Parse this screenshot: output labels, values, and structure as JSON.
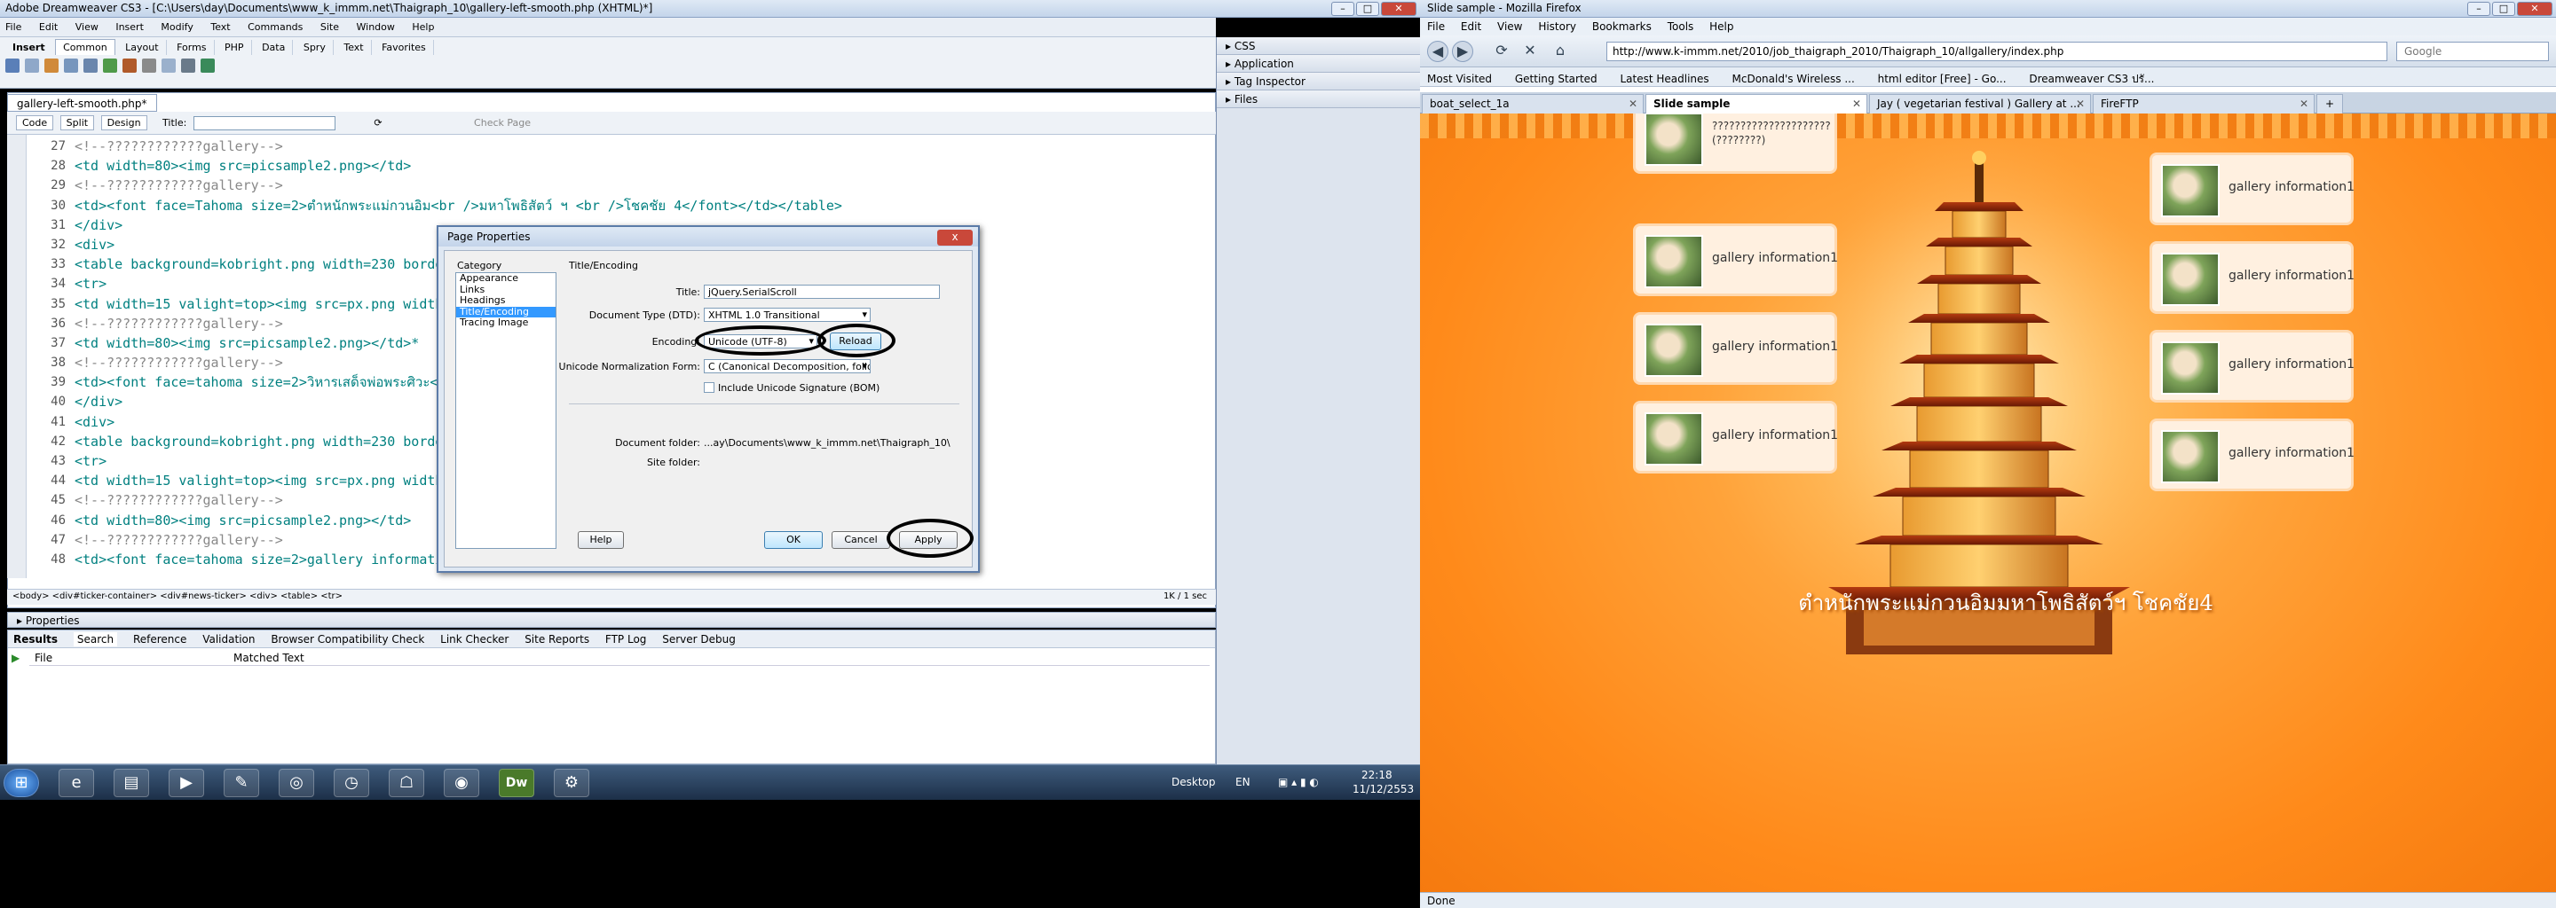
{
  "dreamweaver": {
    "title": "Adobe Dreamweaver CS3 - [C:\\Users\\day\\Documents\\www_k_immm.net\\Thaigraph_10\\gallery-left-smooth.php (XHTML)*]",
    "menu": [
      "File",
      "Edit",
      "View",
      "Insert",
      "Modify",
      "Text",
      "Commands",
      "Site",
      "Window",
      "Help"
    ],
    "insert_label": "Insert",
    "insert_tabs": [
      "Common",
      "Layout",
      "Forms",
      "PHP",
      "Data",
      "Spry",
      "Text",
      "Favorites"
    ],
    "panels": [
      "CSS",
      "Application",
      "Tag Inspector",
      "Files"
    ],
    "doc_tab": "gallery-left-smooth.php*",
    "view_buttons": {
      "code": "Code",
      "split": "Split",
      "design": "Design"
    },
    "title_label": "Title:",
    "check_page": "Check Page",
    "line_numbers": [
      "27",
      "28",
      "29",
      "30",
      "31",
      "32",
      "33",
      "34",
      "35",
      "36",
      "37",
      "38",
      "39",
      "40",
      "41",
      "42",
      "43",
      "44",
      "45",
      "46",
      "47",
      "48"
    ],
    "code_lines": [
      "<!--????????????gallery-->",
      "<td width=80><img src=picsample2.png></td>",
      "<!--????????????gallery-->",
      "<td><font face=Tahoma size=2>ตำหนักพระแม่กวนอิม<br />มหาโพธิสัตว์ ฯ <br />โชคชัย 4</font></td></table>",
      "            </div>",
      "            <div>",
      "<table background=kobright.png width=230 border=",
      "<tr>",
      "<td width=15 valight=top><img src=px.png width=1",
      "<!--????????????gallery-->",
      "<td width=80><img src=picsample2.png></td>*",
      "<!--????????????gallery-->",
      "<td><font face=tahoma size=2>วิหารเสด็จพ่อพระศิวะ<",
      "            </div>",
      "            <div>",
      "<table background=kobright.png width=230 border=",
      "<tr>",
      "<td width=15 valight=top><img src=px.png width=1",
      "<!--????????????gallery-->",
      "<td width=80><img src=picsample2.png></td>",
      "<!--????????????gallery-->",
      "<td><font face=tahoma size=2>gallery information1"
    ],
    "status_path": "<body> <div#ticker-container> <div#news-ticker> <div> <table> <tr>",
    "status_right": "1K / 1 sec",
    "properties": "Properties",
    "results_label": "Results",
    "results_tabs": [
      "Search",
      "Reference",
      "Validation",
      "Browser Compatibility Check",
      "Link Checker",
      "Site Reports",
      "FTP Log",
      "Server Debug"
    ],
    "results_cols": {
      "file": "File",
      "matched": "Matched Text"
    }
  },
  "dialog": {
    "title": "Page Properties",
    "category_label": "Category",
    "categories": [
      "Appearance",
      "Links",
      "Headings",
      "Title/Encoding",
      "Tracing Image"
    ],
    "section": "Title/Encoding",
    "title_field_label": "Title:",
    "title_value": "jQuery.SerialScroll",
    "doctype_label": "Document Type (DTD):",
    "doctype_value": "XHTML 1.0 Transitional",
    "encoding_label": "Encoding:",
    "encoding_value": "Unicode (UTF-8)",
    "reload": "Reload",
    "normalization_label": "Unicode Normalization Form:",
    "normalization_value": "C (Canonical Decomposition, follow",
    "bom_label": "Include Unicode Signature (BOM)",
    "docfolder_label": "Document folder:",
    "docfolder_value": "...ay\\Documents\\www_k_immm.net\\Thaigraph_10\\",
    "sitefolder_label": "Site folder:",
    "help": "Help",
    "ok": "OK",
    "cancel": "Cancel",
    "apply": "Apply",
    "close": "x"
  },
  "taskbar": {
    "desktop": "Desktop",
    "lang": "EN",
    "time": "22:18",
    "date": "11/12/2553",
    "dw_label": "Dw"
  },
  "firefox": {
    "title": "Slide sample - Mozilla Firefox",
    "menu": [
      "File",
      "Edit",
      "View",
      "History",
      "Bookmarks",
      "Tools",
      "Help"
    ],
    "url": "http://www.k-immm.net/2010/job_thaigraph_2010/Thaigraph_10/allgallery/index.php",
    "search_placeholder": "Google",
    "bookmarks": [
      "Most Visited",
      "Getting Started",
      "Latest Headlines",
      "McDonald's Wireless ...",
      "html editor [Free] - Go...",
      "Dreamweaver CS3 ปรั..."
    ],
    "tabs": [
      "boat_select_1a",
      "Slide sample",
      "Jay ( vegetarian festival ) Gallery at ...",
      "FireFTP"
    ],
    "status": "Done",
    "page": {
      "left_top_caption": "?????????????????????",
      "left_top_caption2": "(????????)",
      "gallery_caption": "gallery information1",
      "thai_title": "ตำหนักพระแม่กวนอิมมหาโพธิสัตว์ฯ โชคชัย4"
    }
  },
  "colors": {
    "accent": "#3399ff",
    "page_orange": "#ff8a1a",
    "annotation": "#000000"
  }
}
